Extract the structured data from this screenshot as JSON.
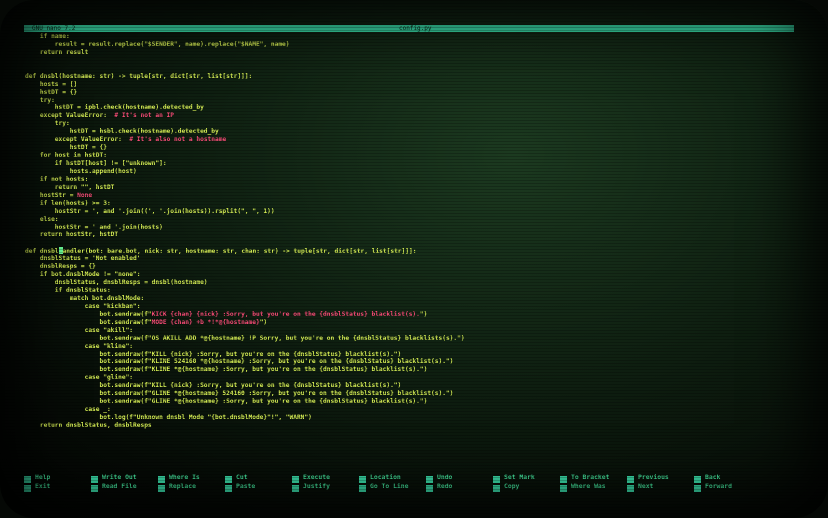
{
  "titlebar": {
    "left": "GNU nano 7.2",
    "filename": "config.py"
  },
  "code": [
    [
      {
        "t": "    if name:"
      }
    ],
    [
      {
        "t": "        result = result.replace(\"$SENDER\", name).replace(\"$NAME\", name)"
      }
    ],
    [
      {
        "t": "    return result"
      }
    ],
    [
      {
        "t": ""
      }
    ],
    [
      {
        "t": ""
      }
    ],
    [
      {
        "t": "def dnsbl(hostname: str) -> tuple[str, dict[str, list[str]]]:"
      }
    ],
    [
      {
        "t": "    hosts = []"
      }
    ],
    [
      {
        "t": "    hstDT = {}"
      }
    ],
    [
      {
        "t": "    try:"
      }
    ],
    [
      {
        "t": "        hstDT = ipbl.check(hostname).detected_by"
      }
    ],
    [
      {
        "t": "    except ValueError:  "
      },
      {
        "t": "# It's not an IP",
        "c": "cm"
      }
    ],
    [
      {
        "t": "        try:"
      }
    ],
    [
      {
        "t": "            hstDT = hsbl.check(hostname).detected_by"
      }
    ],
    [
      {
        "t": "        except ValueError:  "
      },
      {
        "t": "# It's also not a hostname",
        "c": "cm"
      }
    ],
    [
      {
        "t": "            hstDT = {}"
      }
    ],
    [
      {
        "t": "    for host in hstDT:"
      }
    ],
    [
      {
        "t": "        if hstDT[host] != [\"unknown\"]:"
      }
    ],
    [
      {
        "t": "            hosts.append(host)"
      }
    ],
    [
      {
        "t": "    if not hosts:"
      }
    ],
    [
      {
        "t": "        return \"\", hstDT"
      }
    ],
    [
      {
        "t": "    hostStr = "
      },
      {
        "t": "None",
        "c": "cm"
      }
    ],
    [
      {
        "t": "    if len(hosts) >= 3:"
      }
    ],
    [
      {
        "t": "        hostStr = ', and '.join((', '.join(hosts)).rsplit(\", \", 1))"
      }
    ],
    [
      {
        "t": "    else:"
      }
    ],
    [
      {
        "t": "        hostStr = ' and '.join(hosts)"
      }
    ],
    [
      {
        "t": "    return hostStr, hstDT"
      }
    ],
    [
      {
        "t": ""
      }
    ],
    [
      {
        "t": "def dnsbl"
      },
      {
        "t": "",
        "c": "cursor"
      },
      {
        "t": "andler(bot: bare.bot, nick: str, hostname: str, chan: str) -> tuple[str, dict[str, list[str]]]:"
      }
    ],
    [
      {
        "t": "    dnsblStatus = 'Not enabled'"
      }
    ],
    [
      {
        "t": "    dnsblResps = {}"
      }
    ],
    [
      {
        "t": "    if bot.dnsblMode != \"none\":"
      }
    ],
    [
      {
        "t": "        dnsblStatus, dnsblResps = dnsbl(hostname)"
      }
    ],
    [
      {
        "t": "        if dnsblStatus:"
      }
    ],
    [
      {
        "t": "            match bot.dnsblMode:"
      }
    ],
    [
      {
        "t": "                case \"kickban\":"
      }
    ],
    [
      {
        "t": "                    bot.sendraw(f\""
      },
      {
        "t": "KICK {chan} {nick} :Sorry, but you're on the {dnsblStatus} blacklist(s).",
        "c": "st"
      },
      {
        "t": "\")"
      }
    ],
    [
      {
        "t": "                    bot.sendraw(f\""
      },
      {
        "t": "MODE {chan} +b *!*@{hostname}",
        "c": "st"
      },
      {
        "t": "\")"
      }
    ],
    [
      {
        "t": "                case \"akill\":"
      }
    ],
    [
      {
        "t": "                    bot.sendraw(f\"OS AKILL ADD *@{hostname} !P Sorry, but you're on the {dnsblStatus} blacklists(s).\")"
      }
    ],
    [
      {
        "t": "                case \"kline\":"
      }
    ],
    [
      {
        "t": "                    bot.sendraw(f\"KILL {nick} :Sorry, but you're on the {dnsblStatus} blacklist(s).\")"
      }
    ],
    [
      {
        "t": "                    bot.sendraw(f\"KLINE 524160 *@{hostname} :Sorry, but you're on the {dnsblStatus} blacklist(s).\")"
      }
    ],
    [
      {
        "t": "                    bot.sendraw(f\"KLINE *@{hostname} :Sorry, but you're on the {dnsblStatus} blacklist(s).\")"
      }
    ],
    [
      {
        "t": "                case \"gline\":"
      }
    ],
    [
      {
        "t": "                    bot.sendraw(f\"KILL {nick} :Sorry, but you're on the {dnsblStatus} blacklist(s).\")"
      }
    ],
    [
      {
        "t": "                    bot.sendraw(f\"GLINE *@{hostname} 524160 :Sorry, but you're on the {dnsblStatus} blacklist(s).\")"
      }
    ],
    [
      {
        "t": "                    bot.sendraw(f\"GLINE *@{hostname} :Sorry, but you're on the {dnsblStatus} blacklist(s).\")"
      }
    ],
    [
      {
        "t": "                case _:"
      }
    ],
    [
      {
        "t": "                    bot.log(f\"Unknown dnsbl Mode \"{bot.dnsblMode}\"!\", \"WARN\")"
      }
    ],
    [
      {
        "t": "    return dnsblStatus, dnsblResps"
      }
    ]
  ],
  "shortcuts": [
    {
      "key1": "^G",
      "label1": "Help",
      "key2": "^X",
      "label2": "Exit"
    },
    {
      "key1": "^O",
      "label1": "Write Out",
      "key2": "^R",
      "label2": "Read File"
    },
    {
      "key1": "^W",
      "label1": "Where Is",
      "key2": "^\\",
      "label2": "Replace"
    },
    {
      "key1": "^K",
      "label1": "Cut",
      "key2": "^U",
      "label2": "Paste"
    },
    {
      "key1": "^T",
      "label1": "Execute",
      "key2": "^J",
      "label2": "Justify"
    },
    {
      "key1": "^C",
      "label1": "Location",
      "key2": "^/",
      "label2": "Go To Line"
    },
    {
      "key1": "M-U",
      "label1": "Undo",
      "key2": "M-E",
      "label2": "Redo"
    },
    {
      "key1": "M-A",
      "label1": "Set Mark",
      "key2": "M-6",
      "label2": "Copy"
    },
    {
      "key1": "M-]",
      "label1": "To Bracket",
      "key2": "^Q",
      "label2": "Where Was"
    },
    {
      "key1": "M-W",
      "label1": "Previous",
      "key2": "^W",
      "label2": "Next"
    },
    {
      "key1": "^B",
      "label1": "Back",
      "key2": "^F",
      "label2": "Forward"
    }
  ],
  "colors": {
    "code_text": "#d8f055",
    "highlight": "#ff4d7a",
    "titlebar_bg": "#3ff0b8",
    "shortcut_text": "#49f5a8"
  }
}
